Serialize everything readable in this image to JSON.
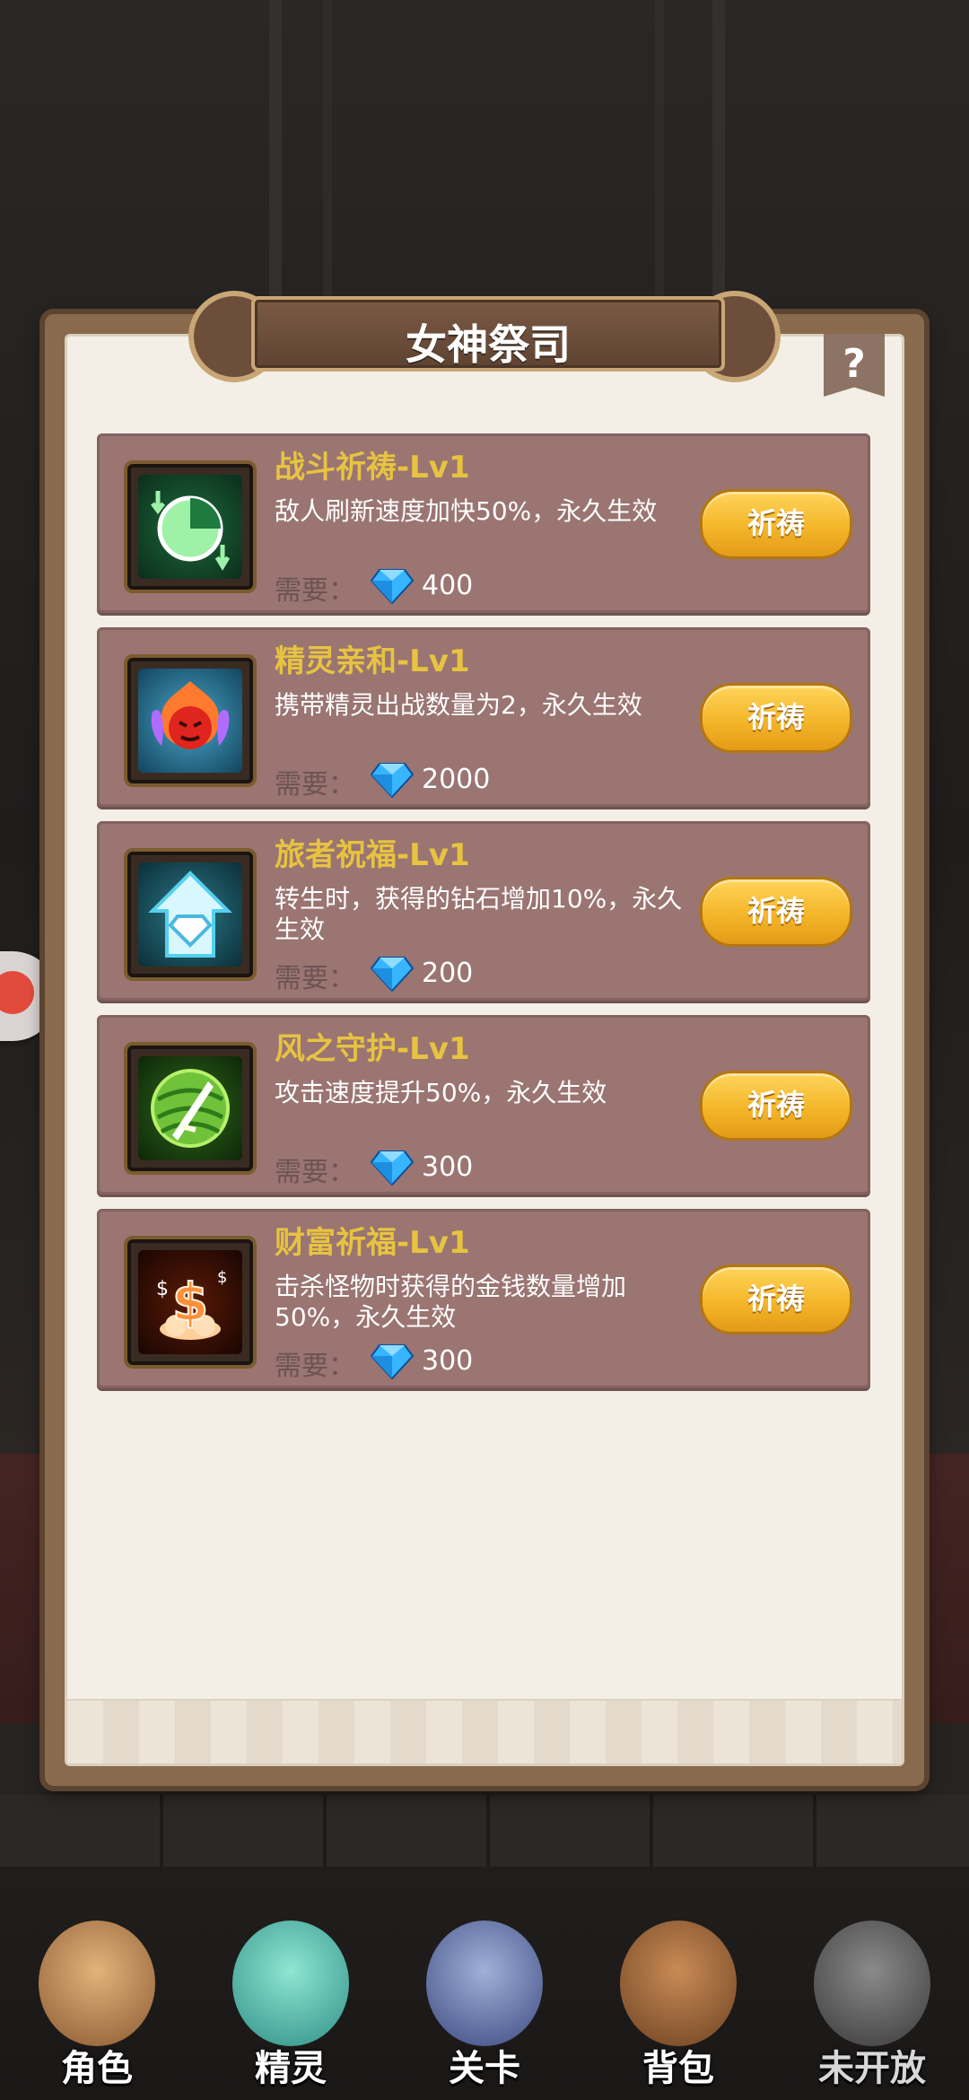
{
  "header": {
    "title": "女神祭司",
    "help_icon": "question-mark"
  },
  "blessings": [
    {
      "title": "战斗祈祷-Lv1",
      "desc": "敌人刷新速度加快50%，永久生效",
      "req_label": "需要：",
      "cost": "400",
      "button": "祈祷",
      "icon": "clock-speed-icon"
    },
    {
      "title": "精灵亲和-Lv1",
      "desc": "携带精灵出战数量为2，永久生效",
      "req_label": "需要：",
      "cost": "2000",
      "button": "祈祷",
      "icon": "spirit-flame-icon"
    },
    {
      "title": "旅者祝福-Lv1",
      "desc": "转生时，获得的钻石增加10%，永久生效",
      "req_label": "需要：",
      "cost": "200",
      "button": "祈祷",
      "icon": "diamond-arrow-icon"
    },
    {
      "title": "风之守护-Lv1",
      "desc": "攻击速度提升50%，永久生效",
      "req_label": "需要：",
      "cost": "300",
      "button": "祈祷",
      "icon": "wind-sword-icon"
    },
    {
      "title": "财富祈福-Lv1",
      "desc": "击杀怪物时获得的金钱数量增加50%，永久生效",
      "req_label": "需要：",
      "cost": "300",
      "button": "祈祷",
      "icon": "gold-money-icon"
    }
  ],
  "nav": [
    {
      "label": "角色",
      "icon": "character-icon"
    },
    {
      "label": "精灵",
      "icon": "spirit-icon"
    },
    {
      "label": "关卡",
      "icon": "stage-icon"
    },
    {
      "label": "背包",
      "icon": "backpack-icon"
    },
    {
      "label": "未开放",
      "icon": "locked-icon"
    }
  ],
  "colors": {
    "card_bg": "#9a7571",
    "title_gold": "#e7c341",
    "button_gold": "#f4b62a"
  }
}
